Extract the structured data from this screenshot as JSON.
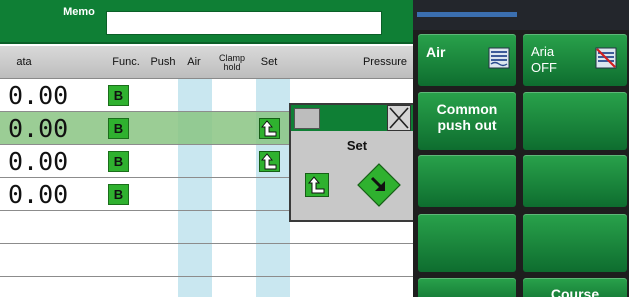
{
  "memo": {
    "label": "Memo",
    "value": ""
  },
  "table": {
    "headers": {
      "data": "ata",
      "func": "Func.",
      "push": "Push",
      "air": "Air",
      "clamp": "Clamp\nhold",
      "set": "Set",
      "pressure": "Pressure"
    },
    "rows": [
      {
        "data": "0.00",
        "func": "B",
        "set": false,
        "selected": false
      },
      {
        "data": "0.00",
        "func": "B",
        "set": true,
        "selected": true
      },
      {
        "data": "0.00",
        "func": "B",
        "set": true,
        "selected": false
      },
      {
        "data": "0.00",
        "func": "B",
        "set": false,
        "selected": false
      }
    ]
  },
  "popup": {
    "title": "Set",
    "icons": [
      "set-up-arrow-icon",
      "set-down-diamond-icon"
    ]
  },
  "right_panel": {
    "buttons": [
      {
        "label": "Air",
        "icon": "air-wave-icon"
      },
      {
        "label": "Aria\nOFF",
        "icon": "air-off-icon"
      },
      {
        "label": "Common\npush out"
      },
      {
        "label": ""
      },
      {
        "label": ""
      },
      {
        "label": ""
      },
      {
        "label": ""
      },
      {
        "label": ""
      },
      {
        "label": ""
      },
      {
        "label": "Course"
      }
    ]
  },
  "colors": {
    "brand_green": "#0f7f35",
    "function_green": "#2fb12f",
    "selected_row": "#8ac482",
    "column_stripe": "#c9e7f0"
  }
}
